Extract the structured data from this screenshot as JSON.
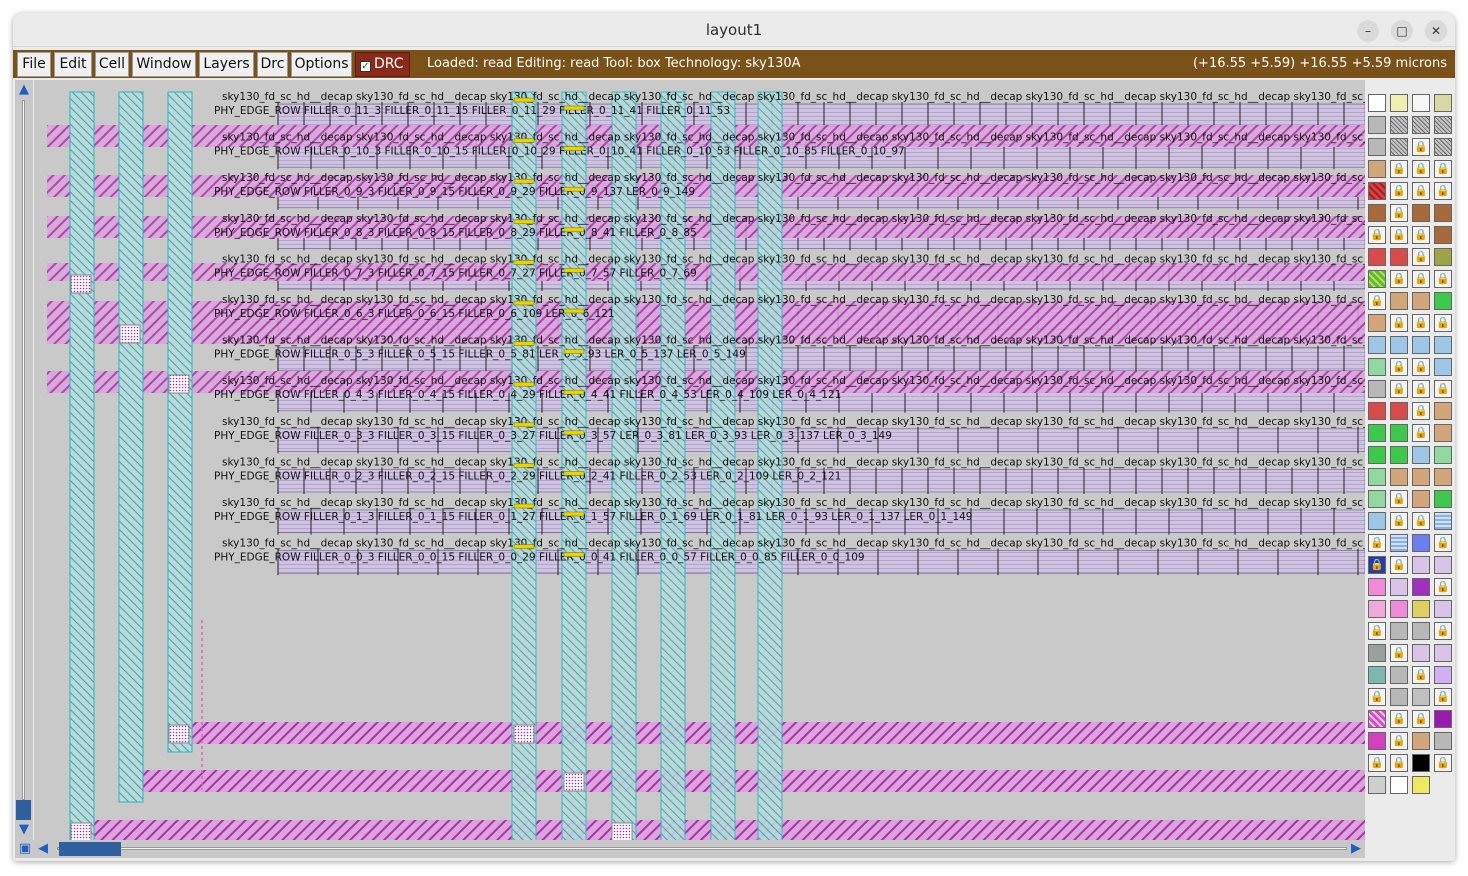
{
  "window": {
    "title": "layout1",
    "controls": [
      "minimize",
      "maximize",
      "close"
    ]
  },
  "menu": {
    "items": [
      "File",
      "Edit",
      "Cell",
      "Window",
      "Layers",
      "Drc",
      "Options"
    ],
    "drc_toggle_label": "DRC",
    "drc_checked": true,
    "status_text": "Loaded: read Editing: read Tool: box  Technology: sky130A",
    "coordinates": "(+16.55 +5.59) +16.55 +5.59 microns"
  },
  "colors": {
    "menubar": "#7a5118",
    "canvas": "#c9c9c9",
    "metal_magenta": "#c03cc0",
    "via_cyan": "#2fb8c0",
    "scrollbar_thumb": "#2f5f9f"
  },
  "layout": {
    "row_prefix": "PHY_EDGE_ROW",
    "rows": [
      {
        "edge": "PHY_EDGE_ROW",
        "cells": "FILLER_0_11_3  FILLER_0_11_15  FILLER_0_11_29  FILLER_0_11_41  FILLER_0_11_53"
      },
      {
        "edge": "PHY_EDGE_ROW",
        "cells": "FILLER_0_10_3  FILLER_0_10_15  FILLER_0_10_29  FILLER_0_10_41  FILLER_0_10_53  FILLER_0_10_85  FILLER_0_10_97"
      },
      {
        "edge": "PHY_EDGE_ROW",
        "cells": "FILLER_0_9_3  FILLER_0_9_15  FILLER_0_9_29  FILLER_0_9_137  LER_0_9_149"
      },
      {
        "edge": "PHY_EDGE_ROW",
        "cells": "FILLER_0_8_3  FILLER_0_8_15  FILLER_0_8_29  FILLER_0_8_41  FILLER_0_8_85"
      },
      {
        "edge": "PHY_EDGE_ROW",
        "cells": "FILLER_0_7_3  FILLER_0_7_15  FILLER_0_7_27  FILLER_0_7_57  FILLER_0_7_69"
      },
      {
        "edge": "PHY_EDGE_ROW",
        "cells": "FILLER_0_6_3  FILLER_0_6_15  FILLER_0_6_109  LER_0_6_121"
      },
      {
        "edge": "PHY_EDGE_ROW",
        "cells": "FILLER_0_5_3  FILLER_0_5_15  FILLER_0_5_81  LER_0_5_93  LER_0_5_137  LER_0_5_149"
      },
      {
        "edge": "PHY_EDGE_ROW",
        "cells": "FILLER_0_4_3  FILLER_0_4_15  FILLER_0_4_29  FILLER_0_4_41  FILLER_0_4_53  LER_0_4_109  LER_0_4_121"
      },
      {
        "edge": "PHY_EDGE_ROW",
        "cells": "FILLER_0_3_3  FILLER_0_3_15  FILLER_0_3_27  FILLER_0_3_57  LER_0_3_81  LER_0_3_93  LER_0_3_137  LER_0_3_149"
      },
      {
        "edge": "PHY_EDGE_ROW",
        "cells": "FILLER_0_2_3  FILLER_0_2_15  FILLER_0_2_29  FILLER_0_2_41  FILLER_0_2_53  LER_0_2_109  LER_0_2_121"
      },
      {
        "edge": "PHY_EDGE_ROW",
        "cells": "FILLER_0_1_3  FILLER_0_1_15  FILLER_0_1_27  FILLER_0_1_57  FILLER_0_1_69  LER_0_1_81  LER_0_1_93  LER_0_1_137  LER_0_1_149"
      },
      {
        "edge": "PHY_EDGE_ROW",
        "cells": "FILLER_0_0_3  FILLER_0_0_15  FILLER_0_0_29  FILLER_0_0_41  FILLER_0_0_57  FILLER_0_0_85  FILLER_0_0_109"
      }
    ],
    "cell_label_line": "sky130_fd_sc_hd__decap  sky130_fd_sc_hd__decap  sky130_fd_sc_hd__decap  sky130_fd_sc_hd__decap  sky130_fd_sc_hd__decap  sky130_fd_sc_hd__decap  sky130_fd_sc_hd__decap  sky130_fd_sc_hd__decap  sky130_fd_sc_hd__decap  sky130_fd_sc_hd__decap"
  },
  "layer_palette": [
    "white-grid",
    "cream-yellow",
    "black-outline",
    "olive-dots",
    "gray",
    "diag-gray",
    "diag-gray",
    "diag-gray",
    "gray",
    "diag-gray",
    "lock",
    "diag-gray",
    "tan",
    "lock",
    "lock",
    "lock",
    "red-hatch",
    "lock",
    "lock",
    "lock",
    "brown",
    "lock",
    "brown",
    "brown",
    "lock",
    "lock",
    "lock",
    "brown",
    "red",
    "red",
    "lock",
    "olive",
    "green-hatch",
    "lock",
    "lock",
    "lock",
    "lock",
    "tan",
    "tan",
    "green",
    "tan",
    "lock",
    "lock",
    "lock",
    "blue-x",
    "blue-x",
    "blue-x",
    "blue-x",
    "green-x",
    "lock",
    "lock",
    "blue-x",
    "gray",
    "lock",
    "lock",
    "lock",
    "red",
    "red",
    "lock",
    "tan",
    "green",
    "green",
    "lock",
    "tan",
    "green",
    "green",
    "blue-x",
    "green-x",
    "green-x",
    "tan",
    "tan",
    "tan",
    "green-x",
    "lock",
    "tan",
    "green",
    "blue-x",
    "lock",
    "lock",
    "blue-lines",
    "lock",
    "blue-lines",
    "blue-check",
    "lock",
    "blue-lock",
    "lock",
    "lavender",
    "lavender",
    "pink",
    "lavender",
    "purple-check",
    "lock",
    "pink-hatch",
    "pink",
    "yellow-check",
    "lavender",
    "lock",
    "gray",
    "gray",
    "lock",
    "black-x",
    "lock",
    "lavender",
    "lavender",
    "teal",
    "gray",
    "lock",
    "purple-lines",
    "lock",
    "gray",
    "diag",
    "lock",
    "magenta-hatch",
    "lock",
    "lock",
    "purple",
    "magenta",
    "lock",
    "tan",
    "gray",
    "lock",
    "lock",
    "black",
    "lock",
    "gray-diag",
    "white-grid",
    "yellow"
  ]
}
